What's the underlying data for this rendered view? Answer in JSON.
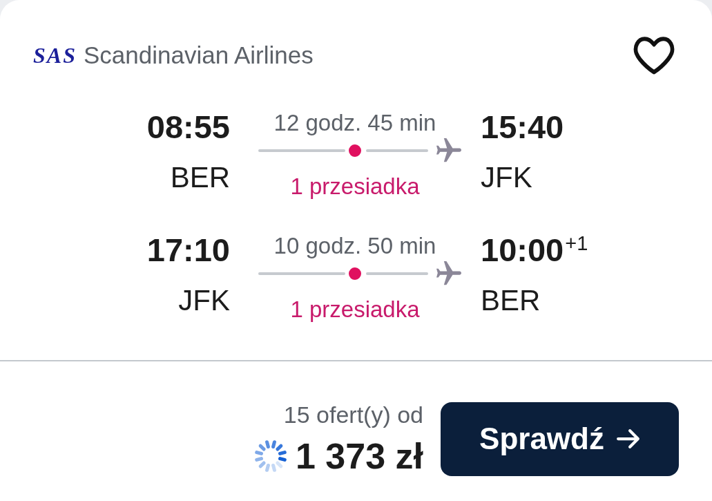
{
  "airline": {
    "logo_text": "SAS",
    "name": "Scandinavian Airlines"
  },
  "favorite": {
    "saved": false
  },
  "legs": [
    {
      "departure": {
        "time": "08:55",
        "airport": "BER"
      },
      "duration": "12 godz. 45 min",
      "stops": "1 przesiadka",
      "arrival": {
        "time": "15:40",
        "airport": "JFK"
      }
    },
    {
      "departure": {
        "time": "17:10",
        "airport": "JFK"
      },
      "duration": "10 godz. 50 min",
      "stops": "1 przesiadka",
      "arrival": {
        "time": "10:00",
        "day_offset": "+1",
        "airport": "BER"
      }
    }
  ],
  "offer": {
    "count_label": "15 ofert(y) od",
    "price": "1 373 zł",
    "loading": true
  },
  "button": {
    "label": "Sprawdź"
  }
}
